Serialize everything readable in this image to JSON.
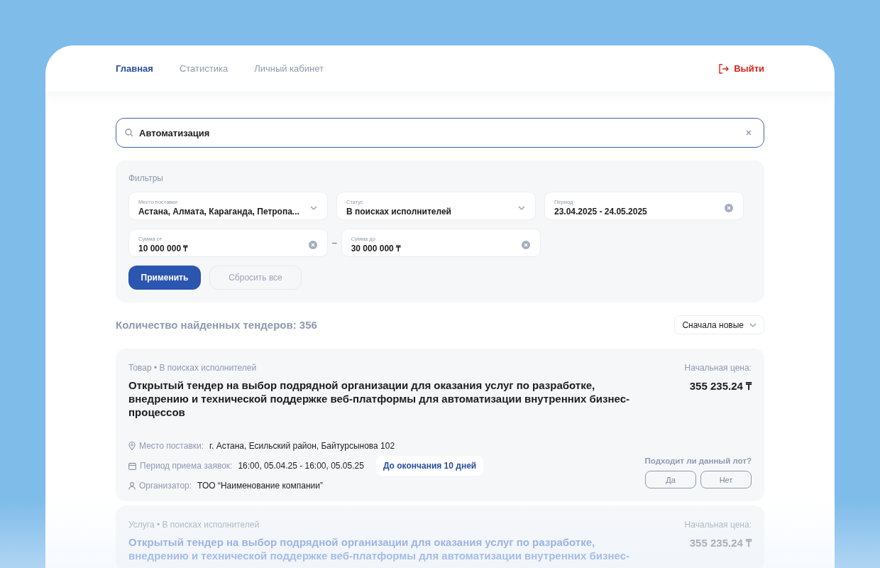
{
  "nav": {
    "items": [
      {
        "label": "Главная",
        "selected": true
      },
      {
        "label": "Статистика",
        "selected": false
      },
      {
        "label": "Личный кабинет",
        "selected": false
      }
    ],
    "logout": "Выйти"
  },
  "search": {
    "value": "Автоматизация"
  },
  "filters": {
    "title": "Фильтры",
    "rows": [
      [
        {
          "kind": "select",
          "label": "Место поставки",
          "value": "Астана, Алмата, Караганда, Петропа..."
        },
        {
          "kind": "select",
          "label": "Статус",
          "value": "В поисках исполнителей"
        },
        {
          "kind": "clearable",
          "label": "Период",
          "value": "23.04.2025 - 24.05.2025"
        }
      ],
      [
        {
          "kind": "clearable",
          "label": "Сумма от",
          "value": "10 000 000 ₸"
        },
        {
          "kind": "clearable",
          "label": "Сумма до",
          "value": "30 000 000 ₸",
          "separator": "–"
        }
      ]
    ],
    "apply": "Применить",
    "reset": "Сбросить все"
  },
  "results": {
    "count": "Количество найденных тендеров: 356",
    "sort": "Сначала новые"
  },
  "tenders": [
    {
      "faded": false,
      "meta": "Товар • В поисках исполнителей",
      "title": "Открытый тендер на выбор подрядной организации для оказания услуг по разработке, внедрению и технической поддержке веб-платформы для автоматизации внутренних бизнес-процессов",
      "price_label": "Начальная цена:",
      "price": "355 235.24 ₸",
      "details": [
        {
          "kind": "location",
          "label": "Место поставки:",
          "value": "г. Астана, Есильский район, Байтурсынова 102"
        },
        {
          "kind": "calendar",
          "label": "Период приема заявок:",
          "value": "16:00, 05.04.25 - 16:00, 05.05.25",
          "badge": "До окончания 10 дней"
        },
        {
          "kind": "person",
          "label": "Организатор:",
          "value": "ТОО “Наименование компании”"
        }
      ],
      "question": "Подходит ли данный лот?",
      "answers": [
        "Да",
        "Нет"
      ]
    },
    {
      "faded": true,
      "meta": "Услуга • В поисках исполнителей",
      "title": "Открытый тендер на выбор подрядной организации для оказания услуг по разработке, внедрению и технической поддержке веб-платформы для автоматизации внутренних бизнес-",
      "price_label": "Начальная цена:",
      "price": "355 235.24 ₸"
    }
  ]
}
